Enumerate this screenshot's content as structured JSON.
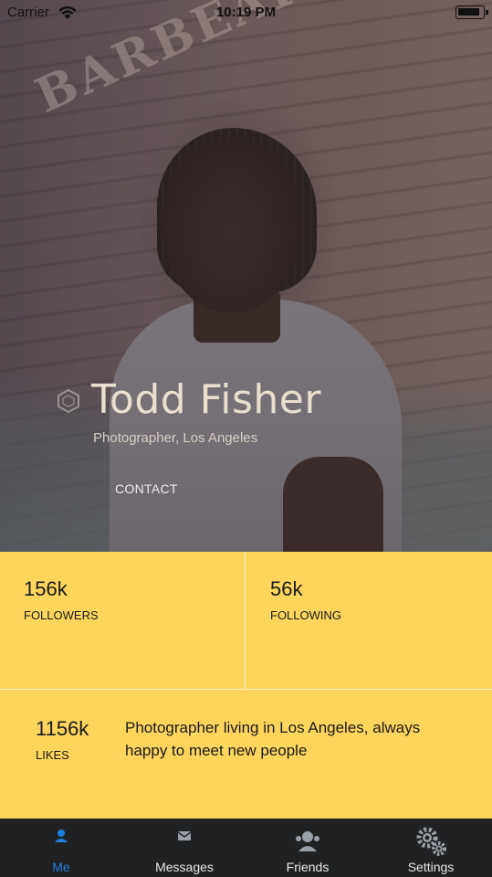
{
  "status_bar": {
    "carrier": "Carrier",
    "time": "10:19 PM",
    "wifi_icon": "wifi-icon",
    "battery_icon": "battery-icon"
  },
  "hero": {
    "sign_text": "BARBEARIA DO ALCIDES",
    "name": "Todd Fisher",
    "subtitle": "Photographer, Los Angeles",
    "contact_label": "CONTACT",
    "badge_icon": "hexagon-icon"
  },
  "stats": {
    "followers": {
      "value": "156k",
      "label": "FOLLOWERS"
    },
    "following": {
      "value": "56k",
      "label": "FOLLOWING"
    },
    "likes": {
      "value": "1156k",
      "label": "LIKES"
    },
    "bio": "Photographer living in Los Angeles, always happy to meet new people"
  },
  "tabbar": {
    "tabs": [
      {
        "label": "Me",
        "icon": "person-icon",
        "active": true
      },
      {
        "label": "Messages",
        "icon": "envelope-icon",
        "active": false
      },
      {
        "label": "Friends",
        "icon": "friends-icon",
        "active": false
      },
      {
        "label": "Settings",
        "icon": "gears-icon",
        "active": false
      }
    ]
  },
  "colors": {
    "stats_background": "#fdd55c",
    "tabbar_background": "#202122",
    "active_tab": "#1f7fe0",
    "name_text": "#e8dfcf"
  }
}
